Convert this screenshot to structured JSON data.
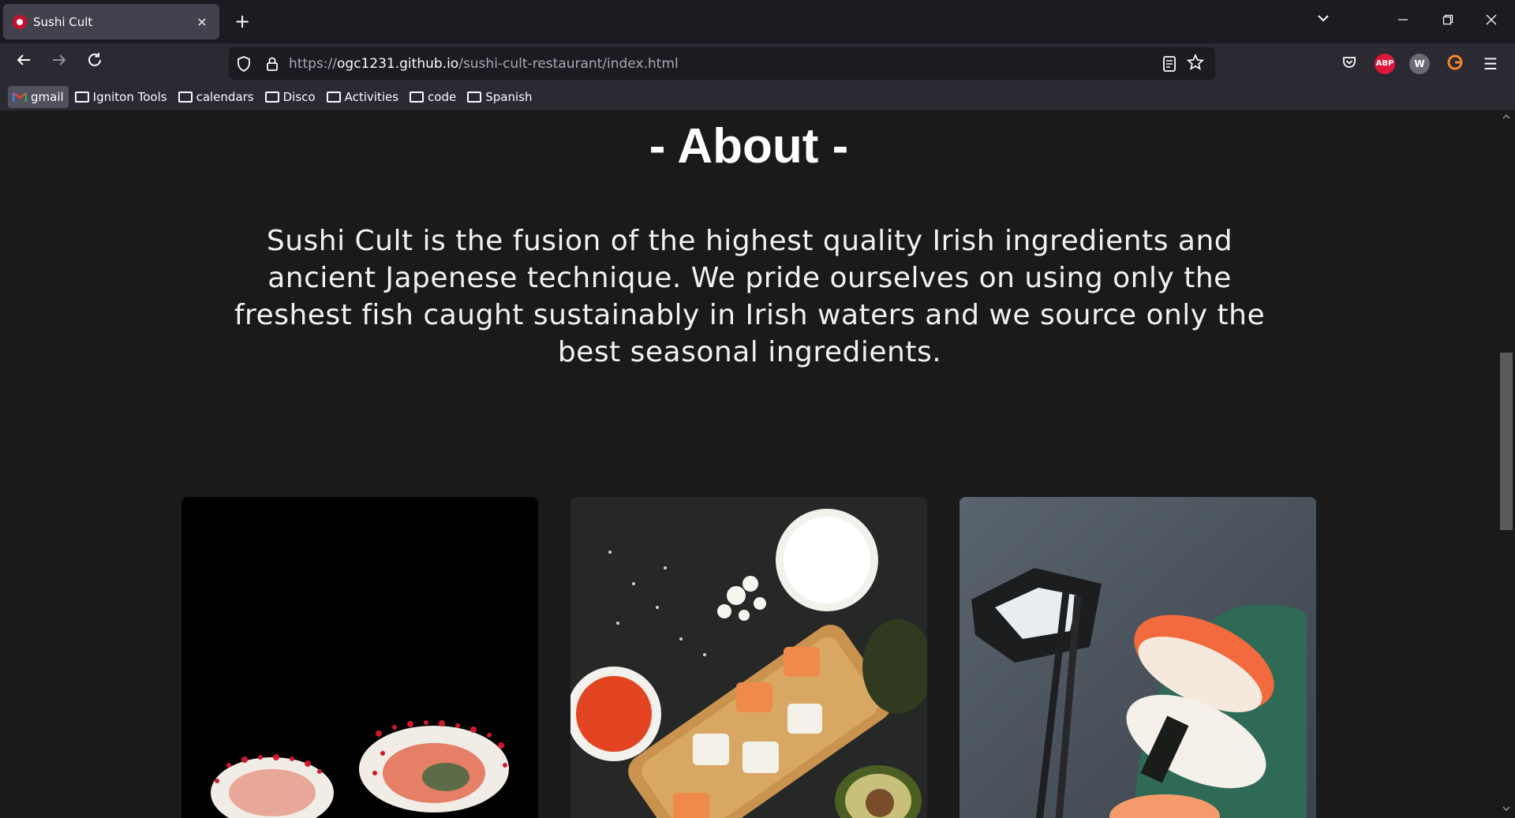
{
  "browser": {
    "tab_title": "Sushi Cult",
    "tab_close": "×",
    "new_tab": "+",
    "url_prefix": "https://",
    "url_host": "ogc1231.github.io",
    "url_path": "/sushi-cult-restaurant/index.html",
    "ext_abp": "ABP",
    "ext_w": "W",
    "menu": "☰"
  },
  "bookmarks": [
    {
      "label": "gmail"
    },
    {
      "label": "Igniton Tools"
    },
    {
      "label": "calendars"
    },
    {
      "label": "Disco"
    },
    {
      "label": "Activities"
    },
    {
      "label": "code"
    },
    {
      "label": "Spanish"
    }
  ],
  "page": {
    "title": "- About -",
    "about_text": "Sushi Cult is the fusion of the highest quality Irish ingredients and ancient Japenese technique. We pride ourselves on using only the freshest fish caught sustainably in Irish waters and we source only the best seasonal ingredients."
  },
  "colors": {
    "page_bg": "#1a1a1a",
    "chrome_bg": "#1c1b22",
    "toolbar_bg": "#2b2a33",
    "abp_red": "#e0153b",
    "grammarly_orange": "#f0862b"
  }
}
